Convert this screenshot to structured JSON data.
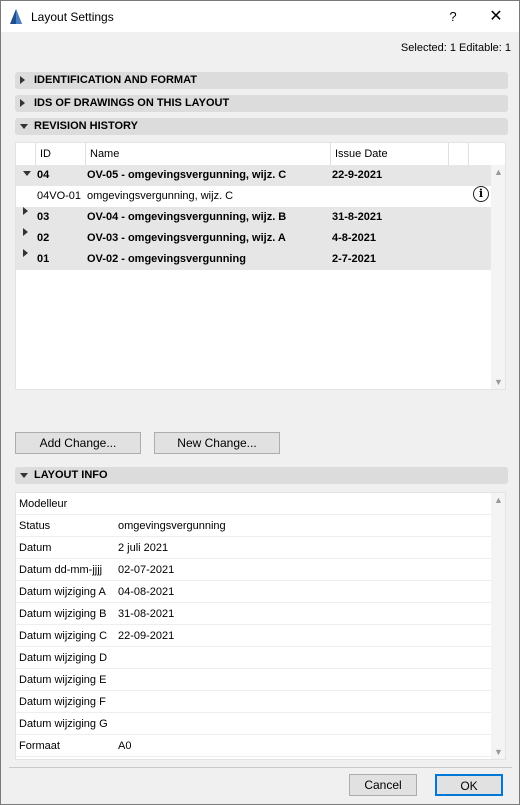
{
  "window": {
    "title": "Layout Settings",
    "help_label": "?",
    "close_label": "✕"
  },
  "selection_info": "Selected: 1 Editable: 1",
  "sections": {
    "identification": "IDENTIFICATION AND FORMAT",
    "ids_of_drawings": "IDS OF DRAWINGS ON THIS LAYOUT",
    "revision_history": "REVISION HISTORY",
    "layout_info": "LAYOUT INFO"
  },
  "revision_table": {
    "columns": [
      "ID",
      "Name",
      "Issue Date"
    ],
    "rows": [
      {
        "id": "04",
        "name": "OV-05 - omgevingsvergunning, wijz. C",
        "date": "22-9-2021",
        "expanded": true
      },
      {
        "id": "04VO-01",
        "name": "omgevingsvergunning, wijz. C",
        "date": ""
      },
      {
        "id": "03",
        "name": "OV-04 - omgevingsvergunning, wijz. B",
        "date": "31-8-2021",
        "expanded": false
      },
      {
        "id": "02",
        "name": "OV-03 - omgevingsvergunning, wijz. A",
        "date": "4-8-2021",
        "expanded": false
      },
      {
        "id": "01",
        "name": "OV-02 - omgevingsvergunning",
        "date": "2-7-2021",
        "expanded": false
      }
    ],
    "info_icon_label": "i"
  },
  "buttons": {
    "add_change": "Add Change...",
    "new_change": "New Change...",
    "cancel": "Cancel",
    "ok": "OK"
  },
  "layout_info": [
    {
      "key": "Modelleur",
      "value": ""
    },
    {
      "key": "Status",
      "value": "omgevingsvergunning"
    },
    {
      "key": "Datum",
      "value": "2 juli 2021"
    },
    {
      "key": "Datum dd-mm-jjjj",
      "value": "02-07-2021"
    },
    {
      "key": "Datum wijziging A",
      "value": "04-08-2021"
    },
    {
      "key": "Datum wijziging B",
      "value": "31-08-2021"
    },
    {
      "key": "Datum wijziging C",
      "value": "22-09-2021"
    },
    {
      "key": "Datum wijziging D",
      "value": ""
    },
    {
      "key": "Datum wijziging E",
      "value": ""
    },
    {
      "key": "Datum wijziging F",
      "value": ""
    },
    {
      "key": "Datum wijziging G",
      "value": ""
    },
    {
      "key": "Formaat",
      "value": "A0"
    }
  ],
  "colors": {
    "accent": "#0078d7",
    "header_bg": "#dcdcdc",
    "group_row_bg": "#e6e6e6"
  },
  "icons": {
    "app": "archicad-sail-icon",
    "expand": "triangle-right-icon",
    "collapse": "triangle-down-icon",
    "info": "info-circle-icon"
  }
}
